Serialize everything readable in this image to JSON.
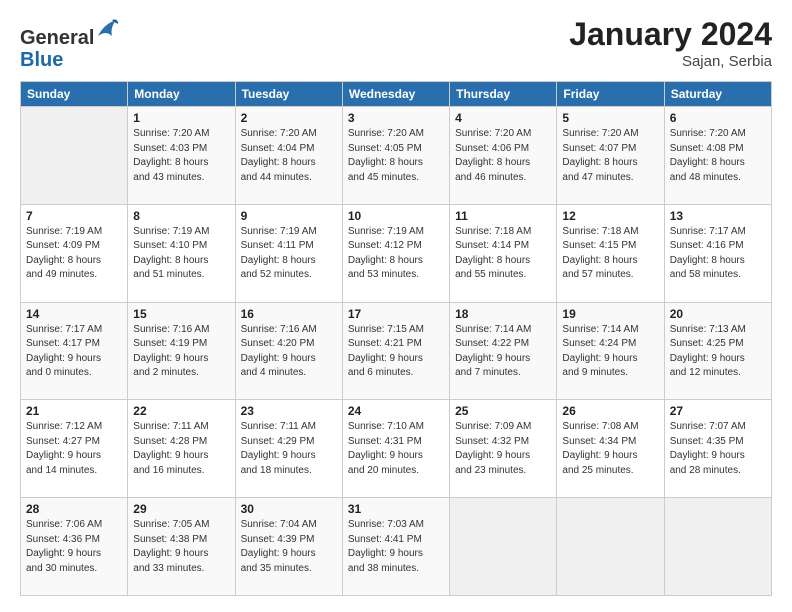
{
  "header": {
    "logo_general": "General",
    "logo_blue": "Blue",
    "month_year": "January 2024",
    "location": "Sajan, Serbia"
  },
  "calendar": {
    "headers": [
      "Sunday",
      "Monday",
      "Tuesday",
      "Wednesday",
      "Thursday",
      "Friday",
      "Saturday"
    ],
    "weeks": [
      [
        {
          "day": "",
          "info": ""
        },
        {
          "day": "1",
          "info": "Sunrise: 7:20 AM\nSunset: 4:03 PM\nDaylight: 8 hours\nand 43 minutes."
        },
        {
          "day": "2",
          "info": "Sunrise: 7:20 AM\nSunset: 4:04 PM\nDaylight: 8 hours\nand 44 minutes."
        },
        {
          "day": "3",
          "info": "Sunrise: 7:20 AM\nSunset: 4:05 PM\nDaylight: 8 hours\nand 45 minutes."
        },
        {
          "day": "4",
          "info": "Sunrise: 7:20 AM\nSunset: 4:06 PM\nDaylight: 8 hours\nand 46 minutes."
        },
        {
          "day": "5",
          "info": "Sunrise: 7:20 AM\nSunset: 4:07 PM\nDaylight: 8 hours\nand 47 minutes."
        },
        {
          "day": "6",
          "info": "Sunrise: 7:20 AM\nSunset: 4:08 PM\nDaylight: 8 hours\nand 48 minutes."
        }
      ],
      [
        {
          "day": "7",
          "info": "Sunrise: 7:19 AM\nSunset: 4:09 PM\nDaylight: 8 hours\nand 49 minutes."
        },
        {
          "day": "8",
          "info": "Sunrise: 7:19 AM\nSunset: 4:10 PM\nDaylight: 8 hours\nand 51 minutes."
        },
        {
          "day": "9",
          "info": "Sunrise: 7:19 AM\nSunset: 4:11 PM\nDaylight: 8 hours\nand 52 minutes."
        },
        {
          "day": "10",
          "info": "Sunrise: 7:19 AM\nSunset: 4:12 PM\nDaylight: 8 hours\nand 53 minutes."
        },
        {
          "day": "11",
          "info": "Sunrise: 7:18 AM\nSunset: 4:14 PM\nDaylight: 8 hours\nand 55 minutes."
        },
        {
          "day": "12",
          "info": "Sunrise: 7:18 AM\nSunset: 4:15 PM\nDaylight: 8 hours\nand 57 minutes."
        },
        {
          "day": "13",
          "info": "Sunrise: 7:17 AM\nSunset: 4:16 PM\nDaylight: 8 hours\nand 58 minutes."
        }
      ],
      [
        {
          "day": "14",
          "info": "Sunrise: 7:17 AM\nSunset: 4:17 PM\nDaylight: 9 hours\nand 0 minutes."
        },
        {
          "day": "15",
          "info": "Sunrise: 7:16 AM\nSunset: 4:19 PM\nDaylight: 9 hours\nand 2 minutes."
        },
        {
          "day": "16",
          "info": "Sunrise: 7:16 AM\nSunset: 4:20 PM\nDaylight: 9 hours\nand 4 minutes."
        },
        {
          "day": "17",
          "info": "Sunrise: 7:15 AM\nSunset: 4:21 PM\nDaylight: 9 hours\nand 6 minutes."
        },
        {
          "day": "18",
          "info": "Sunrise: 7:14 AM\nSunset: 4:22 PM\nDaylight: 9 hours\nand 7 minutes."
        },
        {
          "day": "19",
          "info": "Sunrise: 7:14 AM\nSunset: 4:24 PM\nDaylight: 9 hours\nand 9 minutes."
        },
        {
          "day": "20",
          "info": "Sunrise: 7:13 AM\nSunset: 4:25 PM\nDaylight: 9 hours\nand 12 minutes."
        }
      ],
      [
        {
          "day": "21",
          "info": "Sunrise: 7:12 AM\nSunset: 4:27 PM\nDaylight: 9 hours\nand 14 minutes."
        },
        {
          "day": "22",
          "info": "Sunrise: 7:11 AM\nSunset: 4:28 PM\nDaylight: 9 hours\nand 16 minutes."
        },
        {
          "day": "23",
          "info": "Sunrise: 7:11 AM\nSunset: 4:29 PM\nDaylight: 9 hours\nand 18 minutes."
        },
        {
          "day": "24",
          "info": "Sunrise: 7:10 AM\nSunset: 4:31 PM\nDaylight: 9 hours\nand 20 minutes."
        },
        {
          "day": "25",
          "info": "Sunrise: 7:09 AM\nSunset: 4:32 PM\nDaylight: 9 hours\nand 23 minutes."
        },
        {
          "day": "26",
          "info": "Sunrise: 7:08 AM\nSunset: 4:34 PM\nDaylight: 9 hours\nand 25 minutes."
        },
        {
          "day": "27",
          "info": "Sunrise: 7:07 AM\nSunset: 4:35 PM\nDaylight: 9 hours\nand 28 minutes."
        }
      ],
      [
        {
          "day": "28",
          "info": "Sunrise: 7:06 AM\nSunset: 4:36 PM\nDaylight: 9 hours\nand 30 minutes."
        },
        {
          "day": "29",
          "info": "Sunrise: 7:05 AM\nSunset: 4:38 PM\nDaylight: 9 hours\nand 33 minutes."
        },
        {
          "day": "30",
          "info": "Sunrise: 7:04 AM\nSunset: 4:39 PM\nDaylight: 9 hours\nand 35 minutes."
        },
        {
          "day": "31",
          "info": "Sunrise: 7:03 AM\nSunset: 4:41 PM\nDaylight: 9 hours\nand 38 minutes."
        },
        {
          "day": "",
          "info": ""
        },
        {
          "day": "",
          "info": ""
        },
        {
          "day": "",
          "info": ""
        }
      ]
    ]
  }
}
